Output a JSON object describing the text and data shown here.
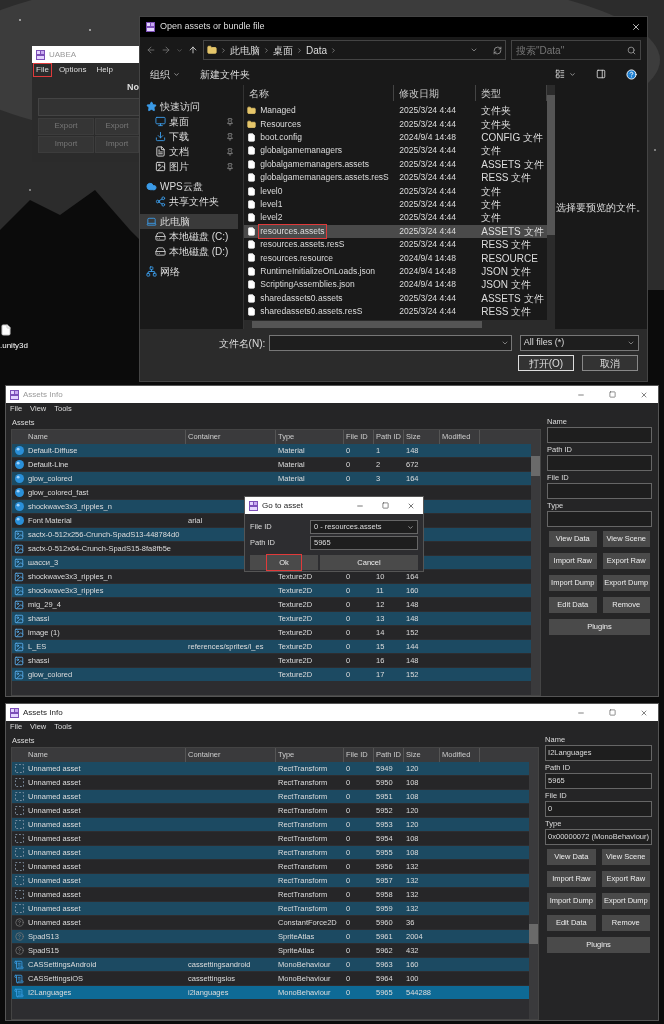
{
  "desktop": {
    "icon_label": ".unity3d"
  },
  "uabea_window": {
    "title": "UABEA",
    "menu": [
      {
        "label": "File",
        "highlighted": true
      },
      {
        "label": "Options",
        "highlighted": false
      },
      {
        "label": "Help",
        "highlighted": false
      }
    ],
    "heading": "No",
    "buttons": [
      {
        "label": "Export",
        "disabled": true
      },
      {
        "label": "Export",
        "disabled": true
      },
      {
        "label": "Import",
        "disabled": true
      },
      {
        "label": "Import",
        "disabled": true
      }
    ]
  },
  "open_dialog": {
    "title": "Open assets or bundle file",
    "breadcrumb": [
      "此电脑",
      "桌面",
      "Data"
    ],
    "search_placeholder": "搜索\"Data\"",
    "toolbar": [
      {
        "label": "组织",
        "dropdown": true
      },
      {
        "label": "新建文件夹",
        "dropdown": false
      }
    ],
    "nav": [
      {
        "label": "快速访问",
        "kind": "star",
        "selected": false,
        "pinned": false,
        "children": [
          {
            "label": "桌面",
            "kind": "desktop",
            "selected": false,
            "pinned": true
          },
          {
            "label": "下载",
            "kind": "download",
            "selected": false,
            "pinned": true
          },
          {
            "label": "文档",
            "kind": "document",
            "selected": false,
            "pinned": true
          },
          {
            "label": "图片",
            "kind": "picture",
            "selected": false,
            "pinned": true
          }
        ]
      },
      {
        "label": "WPS云盘",
        "kind": "cloud",
        "selected": false,
        "pinned": false,
        "children": [
          {
            "label": "共享文件夹",
            "kind": "share",
            "selected": false,
            "pinned": false
          }
        ]
      },
      {
        "label": "此电脑",
        "kind": "computer",
        "selected": true,
        "pinned": false,
        "children": [
          {
            "label": "本地磁盘 (C:)",
            "kind": "drive",
            "selected": false,
            "pinned": false
          },
          {
            "label": "本地磁盘 (D:)",
            "kind": "drive",
            "selected": false,
            "pinned": false
          }
        ]
      },
      {
        "label": "网络",
        "kind": "network",
        "selected": false,
        "pinned": false
      }
    ],
    "columns": [
      "名称",
      "修改日期",
      "类型"
    ],
    "files": [
      {
        "name": "Managed",
        "date": "2025/3/24 4:44",
        "type": "文件夹",
        "kind": "folder",
        "selected": false,
        "highlighted": false
      },
      {
        "name": "Resources",
        "date": "2025/3/24 4:44",
        "type": "文件夹",
        "kind": "folder",
        "selected": false,
        "highlighted": false
      },
      {
        "name": "boot.config",
        "date": "2024/9/4 14:48",
        "type": "CONFIG 文件",
        "kind": "file",
        "selected": false,
        "highlighted": false
      },
      {
        "name": "globalgamemanagers",
        "date": "2025/3/24 4:44",
        "type": "文件",
        "kind": "file",
        "selected": false,
        "highlighted": false
      },
      {
        "name": "globalgamemanagers.assets",
        "date": "2025/3/24 4:44",
        "type": "ASSETS 文件",
        "kind": "file",
        "selected": false,
        "highlighted": false
      },
      {
        "name": "globalgamemanagers.assets.resS",
        "date": "2025/3/24 4:44",
        "type": "RESS 文件",
        "kind": "file",
        "selected": false,
        "highlighted": false
      },
      {
        "name": "level0",
        "date": "2025/3/24 4:44",
        "type": "文件",
        "kind": "file",
        "selected": false,
        "highlighted": false
      },
      {
        "name": "level1",
        "date": "2025/3/24 4:44",
        "type": "文件",
        "kind": "file",
        "selected": false,
        "highlighted": false
      },
      {
        "name": "level2",
        "date": "2025/3/24 4:44",
        "type": "文件",
        "kind": "file",
        "selected": false,
        "highlighted": false
      },
      {
        "name": "resources.assets",
        "date": "2025/3/24 4:44",
        "type": "ASSETS 文件",
        "kind": "file",
        "selected": true,
        "highlighted": true
      },
      {
        "name": "resources.assets.resS",
        "date": "2025/3/24 4:44",
        "type": "RESS 文件",
        "kind": "file",
        "selected": false,
        "highlighted": false
      },
      {
        "name": "resources.resource",
        "date": "2024/9/4 14:48",
        "type": "RESOURCE",
        "kind": "file",
        "selected": false,
        "highlighted": false
      },
      {
        "name": "RuntimeInitializeOnLoads.json",
        "date": "2024/9/4 14:48",
        "type": "JSON 文件",
        "kind": "file",
        "selected": false,
        "highlighted": false
      },
      {
        "name": "ScriptingAssemblies.json",
        "date": "2024/9/4 14:48",
        "type": "JSON 文件",
        "kind": "file",
        "selected": false,
        "highlighted": false
      },
      {
        "name": "sharedassets0.assets",
        "date": "2025/3/24 4:44",
        "type": "ASSETS 文件",
        "kind": "file",
        "selected": false,
        "highlighted": false
      },
      {
        "name": "sharedassets0.assets.resS",
        "date": "2025/3/24 4:44",
        "type": "RESS 文件",
        "kind": "file",
        "selected": false,
        "highlighted": false
      }
    ],
    "preview_text": "选择要预览的文件。",
    "filename_label": "文件名(N):",
    "filter": "All files (*)",
    "buttons": [
      "打开(O)",
      "取消"
    ]
  },
  "assets_windows": [
    {
      "title": "Assets Info",
      "active": false,
      "menu": [
        "File",
        "View",
        "Tools"
      ],
      "section_label": "Assets",
      "columns": [
        "Name",
        "Container",
        "Type",
        "File ID",
        "Path ID",
        "Size",
        "Modified"
      ],
      "rows": [
        {
          "kind": "material",
          "name": "Default-Diffuse",
          "type": "Material",
          "file_id": "0",
          "path_id": "1",
          "size": "148",
          "selected": false
        },
        {
          "kind": "material",
          "name": "Default-Line",
          "type": "Material",
          "file_id": "0",
          "path_id": "2",
          "size": "672",
          "selected": false
        },
        {
          "kind": "material",
          "name": "glow_colored",
          "type": "Material",
          "file_id": "0",
          "path_id": "3",
          "size": "164",
          "selected": false
        },
        {
          "kind": "material",
          "name": "glow_colored_fast",
          "selected": false
        },
        {
          "kind": "material",
          "name": "shockwave3x3_ripples_n",
          "selected": false
        },
        {
          "kind": "material",
          "name": "Font Material",
          "container": "arial",
          "selected": false
        },
        {
          "kind": "texture",
          "name": "sactx-0-512x256-Crunch-SpadS13-448784d0",
          "selected": false
        },
        {
          "kind": "texture",
          "name": "sactx-0-512x64-Crunch-SpadS15-8fa8fb5e",
          "selected": false
        },
        {
          "kind": "texture",
          "name": "шасси_3",
          "selected": false
        },
        {
          "kind": "texture",
          "name": "shockwave3x3_ripples_n",
          "type": "Texture2D",
          "file_id": "0",
          "path_id": "10",
          "size": "164",
          "selected": false
        },
        {
          "kind": "texture",
          "name": "shockwave3x3_ripples",
          "type": "Texture2D",
          "file_id": "0",
          "path_id": "11",
          "size": "160",
          "selected": false
        },
        {
          "kind": "texture",
          "name": "mig_29_4",
          "type": "Texture2D",
          "file_id": "0",
          "path_id": "12",
          "size": "148",
          "selected": false
        },
        {
          "kind": "texture",
          "name": "shassi",
          "type": "Texture2D",
          "file_id": "0",
          "path_id": "13",
          "size": "148",
          "selected": false
        },
        {
          "kind": "texture",
          "name": "image (1)",
          "type": "Texture2D",
          "file_id": "0",
          "path_id": "14",
          "size": "152",
          "selected": false
        },
        {
          "kind": "texture",
          "name": "L_ES",
          "container": "references/sprites/l_es",
          "type": "Texture2D",
          "file_id": "0",
          "path_id": "15",
          "size": "144",
          "selected": false
        },
        {
          "kind": "texture",
          "name": "shassi",
          "type": "Texture2D",
          "file_id": "0",
          "path_id": "16",
          "size": "148",
          "selected": false
        },
        {
          "kind": "texture",
          "name": "glow_colored",
          "type": "Texture2D",
          "file_id": "0",
          "path_id": "17",
          "size": "152",
          "selected": false
        }
      ],
      "fields": [
        {
          "label": "Name"
        },
        {
          "label": "Path ID"
        },
        {
          "label": "File ID"
        },
        {
          "label": "Type"
        }
      ],
      "buttons": [
        "View Data",
        "View Scene",
        "Import Raw",
        "Export Raw",
        "Import Dump",
        "Export Dump",
        "Edit Data",
        "Remove",
        "Plugins"
      ],
      "goto_dialog": {
        "title": "Go to asset",
        "fields": [
          {
            "label": "File ID",
            "value": "0 - resources.assets",
            "kind": "dropdown"
          },
          {
            "label": "Path ID",
            "value": "5965",
            "kind": "text"
          }
        ],
        "buttons": [
          {
            "label": "Ok",
            "highlighted": true
          },
          {
            "label": "Cancel",
            "highlighted": false
          }
        ]
      }
    },
    {
      "title": "Assets Info",
      "active": true,
      "menu": [
        "File",
        "View",
        "Tools"
      ],
      "section_label": "Assets",
      "columns": [
        "Name",
        "Container",
        "Type",
        "File ID",
        "Path ID",
        "Size",
        "Modified"
      ],
      "rows": [
        {
          "kind": "rect",
          "name": "Unnamed asset",
          "type": "RectTransform",
          "file_id": "0",
          "path_id": "5949",
          "size": "120",
          "selected": false
        },
        {
          "kind": "rect",
          "name": "Unnamed asset",
          "type": "RectTransform",
          "file_id": "0",
          "path_id": "5950",
          "size": "108",
          "selected": false
        },
        {
          "kind": "rect",
          "name": "Unnamed asset",
          "type": "RectTransform",
          "file_id": "0",
          "path_id": "5951",
          "size": "108",
          "selected": false
        },
        {
          "kind": "rect",
          "name": "Unnamed asset",
          "type": "RectTransform",
          "file_id": "0",
          "path_id": "5952",
          "size": "120",
          "selected": false
        },
        {
          "kind": "rect",
          "name": "Unnamed asset",
          "type": "RectTransform",
          "file_id": "0",
          "path_id": "5953",
          "size": "120",
          "selected": false
        },
        {
          "kind": "rect",
          "name": "Unnamed asset",
          "type": "RectTransform",
          "file_id": "0",
          "path_id": "5954",
          "size": "108",
          "selected": false
        },
        {
          "kind": "rect",
          "name": "Unnamed asset",
          "type": "RectTransform",
          "file_id": "0",
          "path_id": "5955",
          "size": "108",
          "selected": false
        },
        {
          "kind": "rect",
          "name": "Unnamed asset",
          "type": "RectTransform",
          "file_id": "0",
          "path_id": "5956",
          "size": "132",
          "selected": false
        },
        {
          "kind": "rect",
          "name": "Unnamed asset",
          "type": "RectTransform",
          "file_id": "0",
          "path_id": "5957",
          "size": "132",
          "selected": false
        },
        {
          "kind": "rect",
          "name": "Unnamed asset",
          "type": "RectTransform",
          "file_id": "0",
          "path_id": "5958",
          "size": "132",
          "selected": false
        },
        {
          "kind": "rect",
          "name": "Unnamed asset",
          "type": "RectTransform",
          "file_id": "0",
          "path_id": "5959",
          "size": "132",
          "selected": false
        },
        {
          "kind": "unknown",
          "name": "Unnamed asset",
          "type": "ConstantForce2D",
          "file_id": "0",
          "path_id": "5960",
          "size": "36",
          "selected": false
        },
        {
          "kind": "unknown",
          "name": "SpadS13",
          "type": "SpriteAtlas",
          "file_id": "0",
          "path_id": "5961",
          "size": "2004",
          "selected": false
        },
        {
          "kind": "unknown",
          "name": "SpadS15",
          "type": "SpriteAtlas",
          "file_id": "0",
          "path_id": "5962",
          "size": "432",
          "selected": false
        },
        {
          "kind": "script",
          "name": "CASSettingsAndroid",
          "container": "cassettingsandroid",
          "type": "MonoBehaviour",
          "file_id": "0",
          "path_id": "5963",
          "size": "160",
          "selected": false
        },
        {
          "kind": "script",
          "name": "CASSettingsiOS",
          "container": "cassettingsios",
          "type": "MonoBehaviour",
          "file_id": "0",
          "path_id": "5964",
          "size": "100",
          "selected": false
        },
        {
          "kind": "script",
          "name": "I2Languages",
          "container": "i2languages",
          "type": "MonoBehaviour",
          "file_id": "0",
          "path_id": "5965",
          "size": "544288",
          "selected": true
        }
      ],
      "fields": [
        {
          "label": "Name",
          "value": "I2Languages"
        },
        {
          "label": "Path ID",
          "value": "5965"
        },
        {
          "label": "File ID",
          "value": "0"
        },
        {
          "label": "Type",
          "value": "0x00000072 (MonoBehaviour)"
        }
      ],
      "buttons": [
        "View Data",
        "View Scene",
        "Import Raw",
        "Export Raw",
        "Import Dump",
        "Export Dump",
        "Edit Data",
        "Remove",
        "Plugins"
      ]
    }
  ]
}
